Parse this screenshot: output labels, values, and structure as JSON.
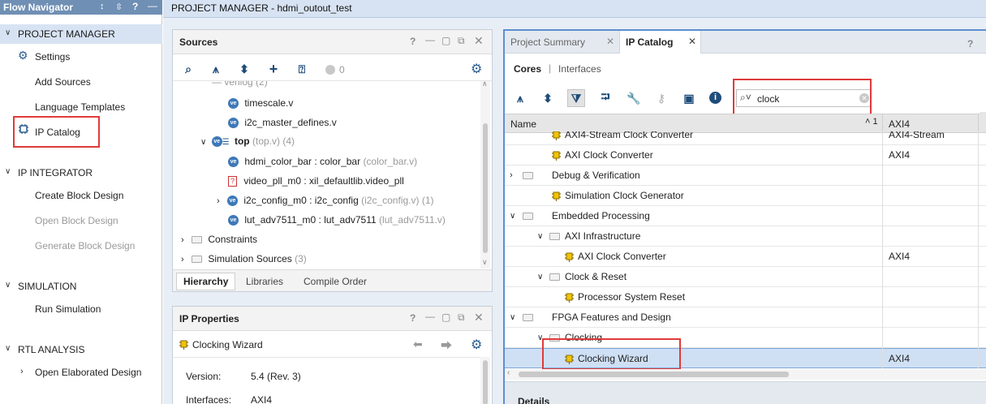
{
  "flow_nav": {
    "title": "Flow Navigator",
    "header_icons": [
      "↕",
      "⬍",
      "?",
      "—"
    ],
    "sections": [
      {
        "label": "PROJECT MANAGER",
        "items": [
          "Settings",
          "Add Sources",
          "Language Templates",
          "IP Catalog"
        ]
      },
      {
        "label": "IP INTEGRATOR",
        "items": [
          "Create Block Design",
          "Open Block Design",
          "Generate Block Design"
        ]
      },
      {
        "label": "SIMULATION",
        "items": [
          "Run Simulation"
        ]
      },
      {
        "label": "RTL ANALYSIS",
        "items": [
          "Open Elaborated Design"
        ]
      }
    ]
  },
  "topbar": {
    "title": "PROJECT MANAGER - hdmi_outout_test"
  },
  "sources": {
    "title": "Sources",
    "count_badge": "0",
    "tree": [
      {
        "text": "timescale.v",
        "suffix": ""
      },
      {
        "text": "i2c_master_defines.v",
        "suffix": ""
      },
      {
        "text": "top",
        "suffix": "(top.v) (4)"
      },
      {
        "text": "hdmi_color_bar : color_bar",
        "suffix": "(color_bar.v)"
      },
      {
        "text": "video_pll_m0 : xil_defaultlib.video_pll",
        "suffix": ""
      },
      {
        "text": "i2c_config_m0 : i2c_config",
        "suffix": "(i2c_config.v) (1)"
      },
      {
        "text": "lut_adv7511_m0 : lut_adv7511",
        "suffix": "(lut_adv7511.v)"
      },
      {
        "text": "Constraints",
        "suffix": ""
      },
      {
        "text": "Simulation Sources",
        "suffix": "(3)"
      }
    ],
    "tabs": [
      "Hierarchy",
      "Libraries",
      "Compile Order"
    ]
  },
  "ip_props": {
    "title": "IP Properties",
    "name": "Clocking Wizard",
    "version_label": "Version:",
    "version_value": "5.4 (Rev. 3)",
    "interfaces_label": "Interfaces:",
    "interfaces_value": "AXI4"
  },
  "catalog": {
    "tabs": [
      "Project Summary",
      "IP Catalog"
    ],
    "subtabs": [
      "Cores",
      "Interfaces"
    ],
    "search_value": "clock",
    "col_name": "Name",
    "col_sort": "˄ 1",
    "col_axi": "AXI4",
    "details_label": "Details",
    "rows": [
      {
        "name": "AXI4-Stream Clock Converter",
        "axi": "AXI4-Stream",
        "kind": "ip"
      },
      {
        "name": "AXI Clock Converter",
        "axi": "AXI4",
        "kind": "ip"
      },
      {
        "name": "Debug & Verification",
        "axi": "",
        "kind": "folder"
      },
      {
        "name": "Simulation Clock Generator",
        "axi": "",
        "kind": "ip"
      },
      {
        "name": "Embedded Processing",
        "axi": "",
        "kind": "folder"
      },
      {
        "name": "AXI Infrastructure",
        "axi": "",
        "kind": "folder"
      },
      {
        "name": "AXI Clock Converter",
        "axi": "AXI4",
        "kind": "ip"
      },
      {
        "name": "Clock & Reset",
        "axi": "",
        "kind": "folder"
      },
      {
        "name": "Processor System Reset",
        "axi": "",
        "kind": "ip"
      },
      {
        "name": "FPGA Features and Design",
        "axi": "",
        "kind": "folder"
      },
      {
        "name": "Clocking",
        "axi": "",
        "kind": "folder"
      },
      {
        "name": "Clocking Wizard",
        "axi": "AXI4",
        "kind": "ip"
      }
    ]
  }
}
